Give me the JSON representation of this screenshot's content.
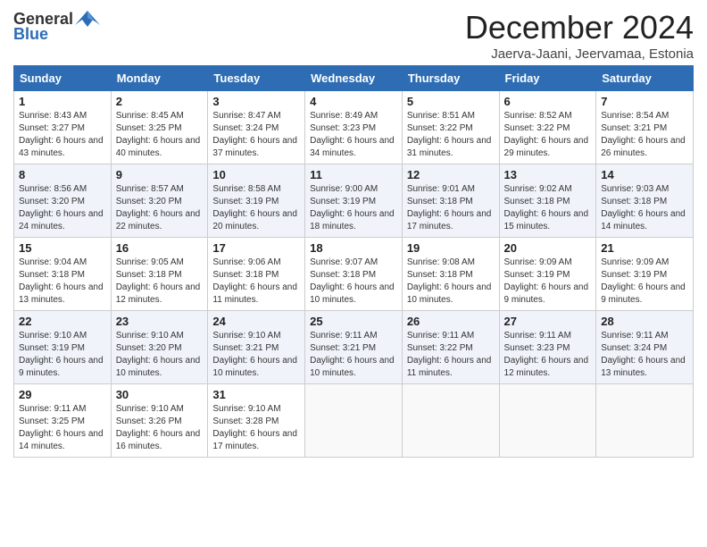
{
  "logo": {
    "general": "General",
    "blue": "Blue"
  },
  "title": "December 2024",
  "location": "Jaerva-Jaani, Jeervamaa, Estonia",
  "days_of_week": [
    "Sunday",
    "Monday",
    "Tuesday",
    "Wednesday",
    "Thursday",
    "Friday",
    "Saturday"
  ],
  "weeks": [
    [
      {
        "day": "1",
        "sunrise": "Sunrise: 8:43 AM",
        "sunset": "Sunset: 3:27 PM",
        "daylight": "Daylight: 6 hours and 43 minutes."
      },
      {
        "day": "2",
        "sunrise": "Sunrise: 8:45 AM",
        "sunset": "Sunset: 3:25 PM",
        "daylight": "Daylight: 6 hours and 40 minutes."
      },
      {
        "day": "3",
        "sunrise": "Sunrise: 8:47 AM",
        "sunset": "Sunset: 3:24 PM",
        "daylight": "Daylight: 6 hours and 37 minutes."
      },
      {
        "day": "4",
        "sunrise": "Sunrise: 8:49 AM",
        "sunset": "Sunset: 3:23 PM",
        "daylight": "Daylight: 6 hours and 34 minutes."
      },
      {
        "day": "5",
        "sunrise": "Sunrise: 8:51 AM",
        "sunset": "Sunset: 3:22 PM",
        "daylight": "Daylight: 6 hours and 31 minutes."
      },
      {
        "day": "6",
        "sunrise": "Sunrise: 8:52 AM",
        "sunset": "Sunset: 3:22 PM",
        "daylight": "Daylight: 6 hours and 29 minutes."
      },
      {
        "day": "7",
        "sunrise": "Sunrise: 8:54 AM",
        "sunset": "Sunset: 3:21 PM",
        "daylight": "Daylight: 6 hours and 26 minutes."
      }
    ],
    [
      {
        "day": "8",
        "sunrise": "Sunrise: 8:56 AM",
        "sunset": "Sunset: 3:20 PM",
        "daylight": "Daylight: 6 hours and 24 minutes."
      },
      {
        "day": "9",
        "sunrise": "Sunrise: 8:57 AM",
        "sunset": "Sunset: 3:20 PM",
        "daylight": "Daylight: 6 hours and 22 minutes."
      },
      {
        "day": "10",
        "sunrise": "Sunrise: 8:58 AM",
        "sunset": "Sunset: 3:19 PM",
        "daylight": "Daylight: 6 hours and 20 minutes."
      },
      {
        "day": "11",
        "sunrise": "Sunrise: 9:00 AM",
        "sunset": "Sunset: 3:19 PM",
        "daylight": "Daylight: 6 hours and 18 minutes."
      },
      {
        "day": "12",
        "sunrise": "Sunrise: 9:01 AM",
        "sunset": "Sunset: 3:18 PM",
        "daylight": "Daylight: 6 hours and 17 minutes."
      },
      {
        "day": "13",
        "sunrise": "Sunrise: 9:02 AM",
        "sunset": "Sunset: 3:18 PM",
        "daylight": "Daylight: 6 hours and 15 minutes."
      },
      {
        "day": "14",
        "sunrise": "Sunrise: 9:03 AM",
        "sunset": "Sunset: 3:18 PM",
        "daylight": "Daylight: 6 hours and 14 minutes."
      }
    ],
    [
      {
        "day": "15",
        "sunrise": "Sunrise: 9:04 AM",
        "sunset": "Sunset: 3:18 PM",
        "daylight": "Daylight: 6 hours and 13 minutes."
      },
      {
        "day": "16",
        "sunrise": "Sunrise: 9:05 AM",
        "sunset": "Sunset: 3:18 PM",
        "daylight": "Daylight: 6 hours and 12 minutes."
      },
      {
        "day": "17",
        "sunrise": "Sunrise: 9:06 AM",
        "sunset": "Sunset: 3:18 PM",
        "daylight": "Daylight: 6 hours and 11 minutes."
      },
      {
        "day": "18",
        "sunrise": "Sunrise: 9:07 AM",
        "sunset": "Sunset: 3:18 PM",
        "daylight": "Daylight: 6 hours and 10 minutes."
      },
      {
        "day": "19",
        "sunrise": "Sunrise: 9:08 AM",
        "sunset": "Sunset: 3:18 PM",
        "daylight": "Daylight: 6 hours and 10 minutes."
      },
      {
        "day": "20",
        "sunrise": "Sunrise: 9:09 AM",
        "sunset": "Sunset: 3:19 PM",
        "daylight": "Daylight: 6 hours and 9 minutes."
      },
      {
        "day": "21",
        "sunrise": "Sunrise: 9:09 AM",
        "sunset": "Sunset: 3:19 PM",
        "daylight": "Daylight: 6 hours and 9 minutes."
      }
    ],
    [
      {
        "day": "22",
        "sunrise": "Sunrise: 9:10 AM",
        "sunset": "Sunset: 3:19 PM",
        "daylight": "Daylight: 6 hours and 9 minutes."
      },
      {
        "day": "23",
        "sunrise": "Sunrise: 9:10 AM",
        "sunset": "Sunset: 3:20 PM",
        "daylight": "Daylight: 6 hours and 10 minutes."
      },
      {
        "day": "24",
        "sunrise": "Sunrise: 9:10 AM",
        "sunset": "Sunset: 3:21 PM",
        "daylight": "Daylight: 6 hours and 10 minutes."
      },
      {
        "day": "25",
        "sunrise": "Sunrise: 9:11 AM",
        "sunset": "Sunset: 3:21 PM",
        "daylight": "Daylight: 6 hours and 10 minutes."
      },
      {
        "day": "26",
        "sunrise": "Sunrise: 9:11 AM",
        "sunset": "Sunset: 3:22 PM",
        "daylight": "Daylight: 6 hours and 11 minutes."
      },
      {
        "day": "27",
        "sunrise": "Sunrise: 9:11 AM",
        "sunset": "Sunset: 3:23 PM",
        "daylight": "Daylight: 6 hours and 12 minutes."
      },
      {
        "day": "28",
        "sunrise": "Sunrise: 9:11 AM",
        "sunset": "Sunset: 3:24 PM",
        "daylight": "Daylight: 6 hours and 13 minutes."
      }
    ],
    [
      {
        "day": "29",
        "sunrise": "Sunrise: 9:11 AM",
        "sunset": "Sunset: 3:25 PM",
        "daylight": "Daylight: 6 hours and 14 minutes."
      },
      {
        "day": "30",
        "sunrise": "Sunrise: 9:10 AM",
        "sunset": "Sunset: 3:26 PM",
        "daylight": "Daylight: 6 hours and 16 minutes."
      },
      {
        "day": "31",
        "sunrise": "Sunrise: 9:10 AM",
        "sunset": "Sunset: 3:28 PM",
        "daylight": "Daylight: 6 hours and 17 minutes."
      },
      null,
      null,
      null,
      null
    ]
  ]
}
